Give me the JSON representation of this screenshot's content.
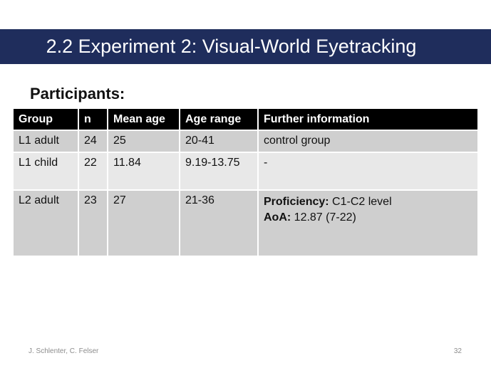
{
  "slide": {
    "title": "2.2 Experiment 2: Visual-World Eyetracking",
    "section_heading": "Participants:"
  },
  "table": {
    "headers": [
      "Group",
      "n",
      "Mean age",
      "Age range",
      "Further information"
    ],
    "rows": [
      {
        "group": "L1 adult",
        "n": "24",
        "mean_age": "25",
        "age_range": "20-41",
        "info": "control group"
      },
      {
        "group": "L1 child",
        "n": "22",
        "mean_age": "11.84",
        "age_range": "9.19-13.75",
        "info": "-"
      },
      {
        "group": "L2 adult",
        "n": "23",
        "mean_age": "27",
        "age_range": "21-36",
        "info_lines": [
          {
            "label": "Proficiency:",
            "value": " C1-C2 level"
          },
          {
            "label": "AoA:",
            "value": " 12.87 (7-22)"
          }
        ]
      }
    ]
  },
  "footer": {
    "authors": "J. Schlenter, C. Felser",
    "page_number": "32"
  }
}
